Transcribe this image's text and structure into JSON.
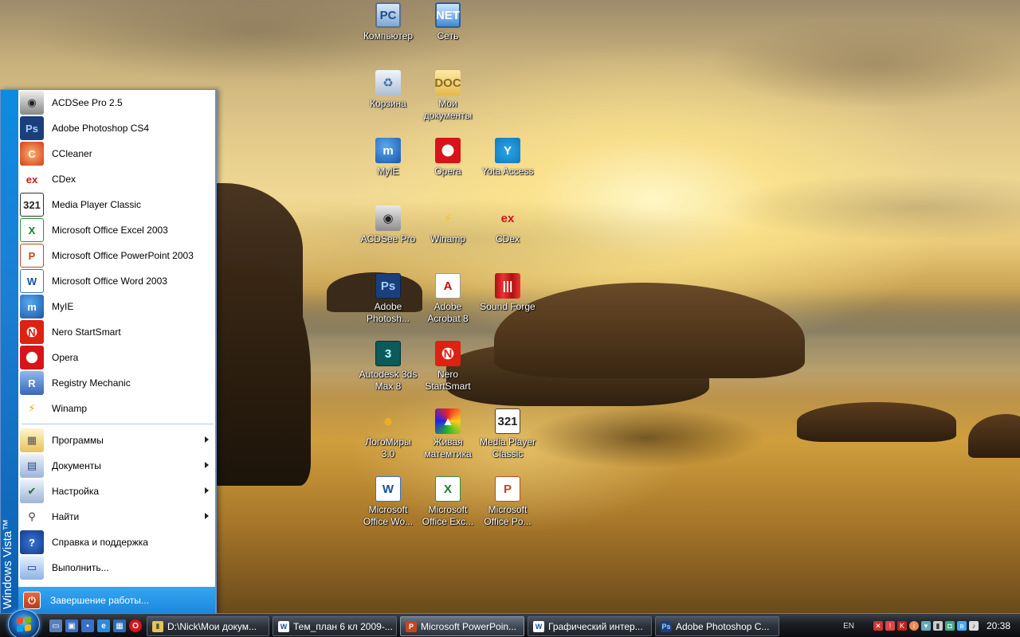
{
  "desktop": {
    "icons": [
      {
        "label": "Компьютер",
        "glyph": "PC"
      },
      {
        "label": "Сеть",
        "glyph": "NET"
      },
      {
        "label": "Корзина",
        "glyph": "♻"
      },
      {
        "label": "Мои\nдокументы",
        "glyph": "DOC"
      },
      {
        "label": "MyIE",
        "glyph": "m"
      },
      {
        "label": "Opera",
        "glyph": "O"
      },
      {
        "label": "Yota Access",
        "glyph": "Y"
      },
      {
        "label": "ACDSee Pro",
        "glyph": "◉"
      },
      {
        "label": "Winamp",
        "glyph": "⚡"
      },
      {
        "label": "CDex",
        "glyph": "ex"
      },
      {
        "label": "Adobe\nPhotosh...",
        "glyph": "Ps"
      },
      {
        "label": "Adobe\nAcrobat 8",
        "glyph": "A"
      },
      {
        "label": "Sound Forge",
        "glyph": "|||"
      },
      {
        "label": "Autodesk 3ds\nMax 8",
        "glyph": "3"
      },
      {
        "label": "Nero\nStartSmart",
        "glyph": "N"
      },
      {
        "label": "ЛогоМиры\n3.0",
        "glyph": "☻"
      },
      {
        "label": "Живая\nматемтика",
        "glyph": "▲"
      },
      {
        "label": "Media Player\nClassic",
        "glyph": "321"
      },
      {
        "label": "Microsoft\nOffice Wo...",
        "glyph": "W"
      },
      {
        "label": "Microsoft\nOffice Exc...",
        "glyph": "X"
      },
      {
        "label": "Microsoft\nOffice Po...",
        "glyph": "P"
      }
    ]
  },
  "start_menu": {
    "banner_text": "Windows Vista™",
    "pinned": [
      {
        "label": "ACDSee Pro 2.5",
        "glyph": "◉"
      },
      {
        "label": "Adobe Photoshop CS4",
        "glyph": "Ps"
      },
      {
        "label": "CCleaner",
        "glyph": "C"
      },
      {
        "label": "CDex",
        "glyph": "ex"
      },
      {
        "label": "Media Player Classic",
        "glyph": "321"
      },
      {
        "label": "Microsoft Office Excel 2003",
        "glyph": "X"
      },
      {
        "label": "Microsoft Office PowerPoint 2003",
        "glyph": "P"
      },
      {
        "label": "Microsoft Office Word 2003",
        "glyph": "W"
      },
      {
        "label": "MyIE",
        "glyph": "m"
      },
      {
        "label": "Nero StartSmart",
        "glyph": "N"
      },
      {
        "label": "Opera",
        "glyph": "O"
      },
      {
        "label": "Registry Mechanic",
        "glyph": "R"
      },
      {
        "label": "Winamp",
        "glyph": "⚡"
      }
    ],
    "system": [
      {
        "label": "Программы",
        "glyph": "▦",
        "submenu": true
      },
      {
        "label": "Документы",
        "glyph": "▤",
        "submenu": true
      },
      {
        "label": "Настройка",
        "glyph": "✔",
        "submenu": true
      },
      {
        "label": "Найти",
        "glyph": "⚲",
        "submenu": true
      },
      {
        "label": "Справка и поддержка",
        "glyph": "?",
        "submenu": false
      },
      {
        "label": "Выполнить...",
        "glyph": "▭",
        "submenu": false
      }
    ],
    "shutdown_label": "Завершение работы..."
  },
  "taskbar": {
    "tasks": [
      {
        "label": "D:\\Nick\\Мои докум...",
        "glyph": "▮",
        "active": false
      },
      {
        "label": "Тем_план 6 кл 2009-...",
        "glyph": "W",
        "active": false
      },
      {
        "label": "Microsoft PowerPoin...",
        "glyph": "P",
        "active": true
      },
      {
        "label": "Графический интер...",
        "glyph": "W",
        "active": false
      },
      {
        "label": "Adobe Photoshop C...",
        "glyph": "Ps",
        "active": false
      }
    ],
    "language": "EN",
    "clock": "20:38"
  },
  "colors": {
    "start_menu_banner": "#1a7fd2",
    "shutdown_highlight": "#2a98ea",
    "taskbar": "#1a1d22"
  }
}
